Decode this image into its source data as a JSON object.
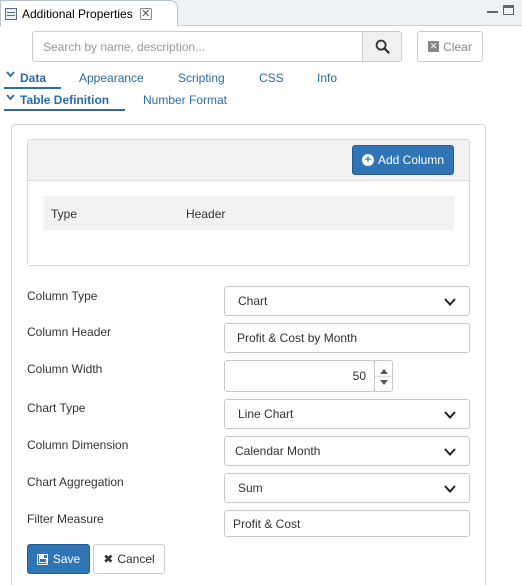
{
  "view": {
    "title": "Additional Properties",
    "close_glyph": "✕"
  },
  "search": {
    "placeholder": "Search by name, description...",
    "clear_label": "Clear"
  },
  "main_tabs": [
    {
      "label": "Data",
      "active": true
    },
    {
      "label": "Appearance",
      "active": false
    },
    {
      "label": "Scripting",
      "active": false
    },
    {
      "label": "CSS",
      "active": false
    },
    {
      "label": "Info",
      "active": false
    }
  ],
  "sub_tabs": [
    {
      "label": "Table Definition",
      "active": true
    },
    {
      "label": "Number Format",
      "active": false
    }
  ],
  "columns_grid": {
    "add_button_label": "Add Column",
    "headers": [
      "Type",
      "Header"
    ]
  },
  "form": {
    "column_type": {
      "label": "Column Type",
      "value": "Chart"
    },
    "column_header": {
      "label": "Column Header",
      "value": "Profit & Cost by Month"
    },
    "column_width": {
      "label": "Column Width",
      "value": "50"
    },
    "chart_type": {
      "label": "Chart Type",
      "value": "Line Chart"
    },
    "column_dimension": {
      "label": "Column Dimension",
      "value": "Calendar Month"
    },
    "chart_aggregation": {
      "label": "Chart Aggregation",
      "value": "Sum"
    },
    "filter_measure": {
      "label": "Filter Measure",
      "value": "Profit & Cost"
    }
  },
  "actions": {
    "save_label": "Save",
    "cancel_label": "Cancel"
  },
  "colors": {
    "accent": "#2f74b5",
    "tab_text": "#2a6ba3"
  }
}
